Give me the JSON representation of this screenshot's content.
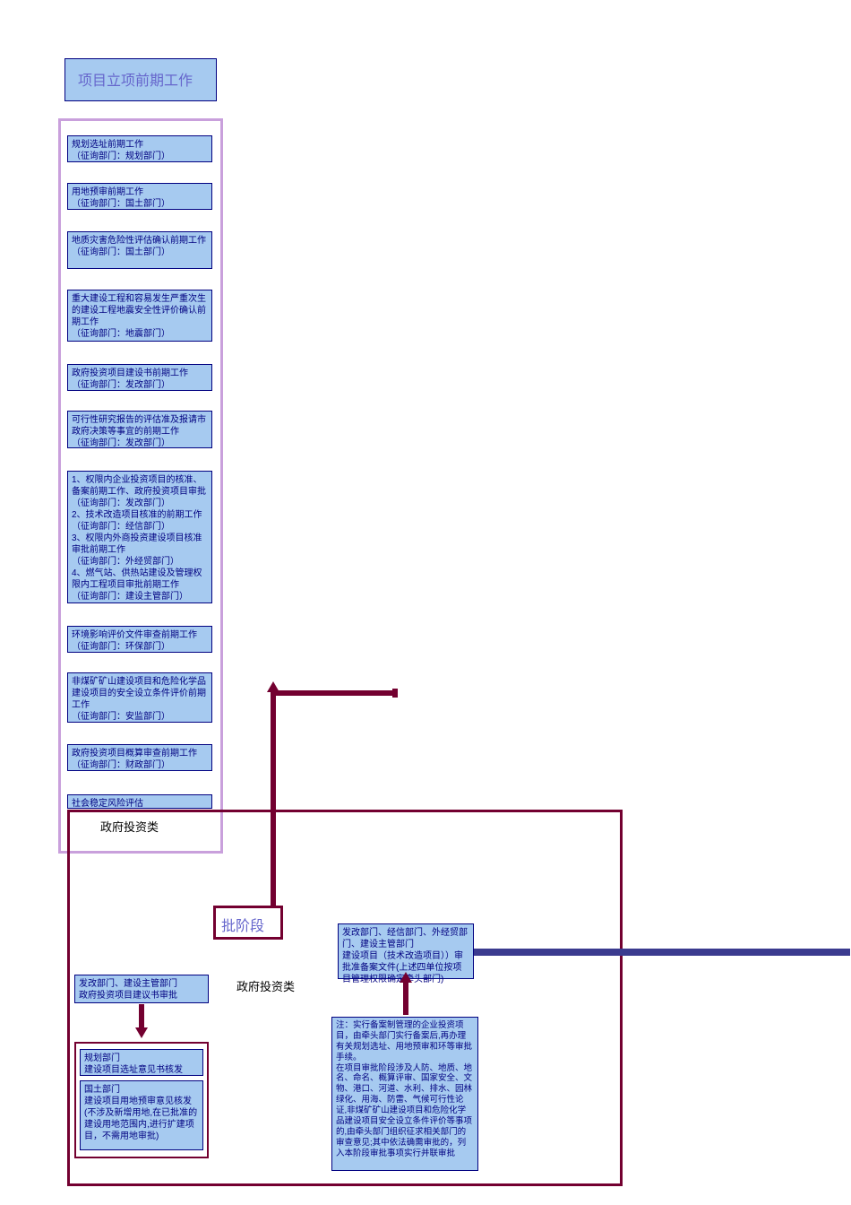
{
  "title": "项目立项前期工作",
  "prelim": {
    "b1": "规划选址前期工作\n（征询部门：规划部门）",
    "b2": "用地预审前期工作\n（征询部门：国土部门）",
    "b3": "地质灾害危险性评估确认前期工作\n（征询部门：国土部门）",
    "b4": "重大建设工程和容易发生严重次生的建设工程地震安全性评价确认前期工作\n（征询部门：地震部门）",
    "b5": "政府投资项目建设书前期工作\n（征询部门：发改部门）",
    "b6": "可行性研究报告的评估准及报请市政府决策等事宜的前期工作\n（征询部门：发改部门）",
    "b7": "1、权限内企业投资项目的核准、备案前期工作、政府投资项目审批\n（征询部门：发改部门）\n2、技术改造项目核准的前期工作\n（征询部门：经信部门）\n3、权限内外商投资建设项目核准审批前期工作\n（征询部门：外经贸部门）\n4、燃气站、供热站建设及管理权限内工程项目审批前期工作\n（征询部门：建设主管部门）",
    "b8": "环境影响评价文件审查前期工作\n（征询部门：环保部门）",
    "b9": "非煤矿矿山建设项目和危险化学品建设项目的安全设立条件评价前期工作\n（征询部门：安监部门）",
    "b10": "政府投资项目概算审查前期工作\n（征询部门：财政部门）",
    "b11": "社会稳定风险评估"
  },
  "labels": {
    "gov_invest_top": "政府投资类",
    "stage_piece": "批阶段",
    "gov_invest_left": "政府投资类"
  },
  "stage": {
    "left_top": "发改部门、建设主管部门\n政府投资项目建议书审批",
    "left_sub1": "规划部门\n建设项目选址意见书核发",
    "left_sub2": "国土部门\n建设项目用地预审意见核发(不涉及新增用地,在已批准的建设用地范围内,进行扩建项目，不需用地审批)",
    "right_top": "发改部门、经信部门、外经贸部门、建设主管部门\n建设项目（技术改造项目））审批准备案文件(上述四单位按项目管理权限确定牵头部门)",
    "right_note": "注：实行备案制管理的企业投资项目，由牵头部门实行备案后,再办理有关规划选址、用地预审和环等审批手续。\n        在项目审批阶段涉及人防、地质、地名、命名、概算评审、国家安全、文物、港口、河道、水利、排水、园林绿化、用海、防雷、气候可行性论证,非煤矿矿山建设项目和危险化学品建设项目安全设立条件评价等事项的,由牵头部门组织征求相关部门的审查意见;其中依法确需审批的，列入本阶段审批事项实行并联审批"
  }
}
